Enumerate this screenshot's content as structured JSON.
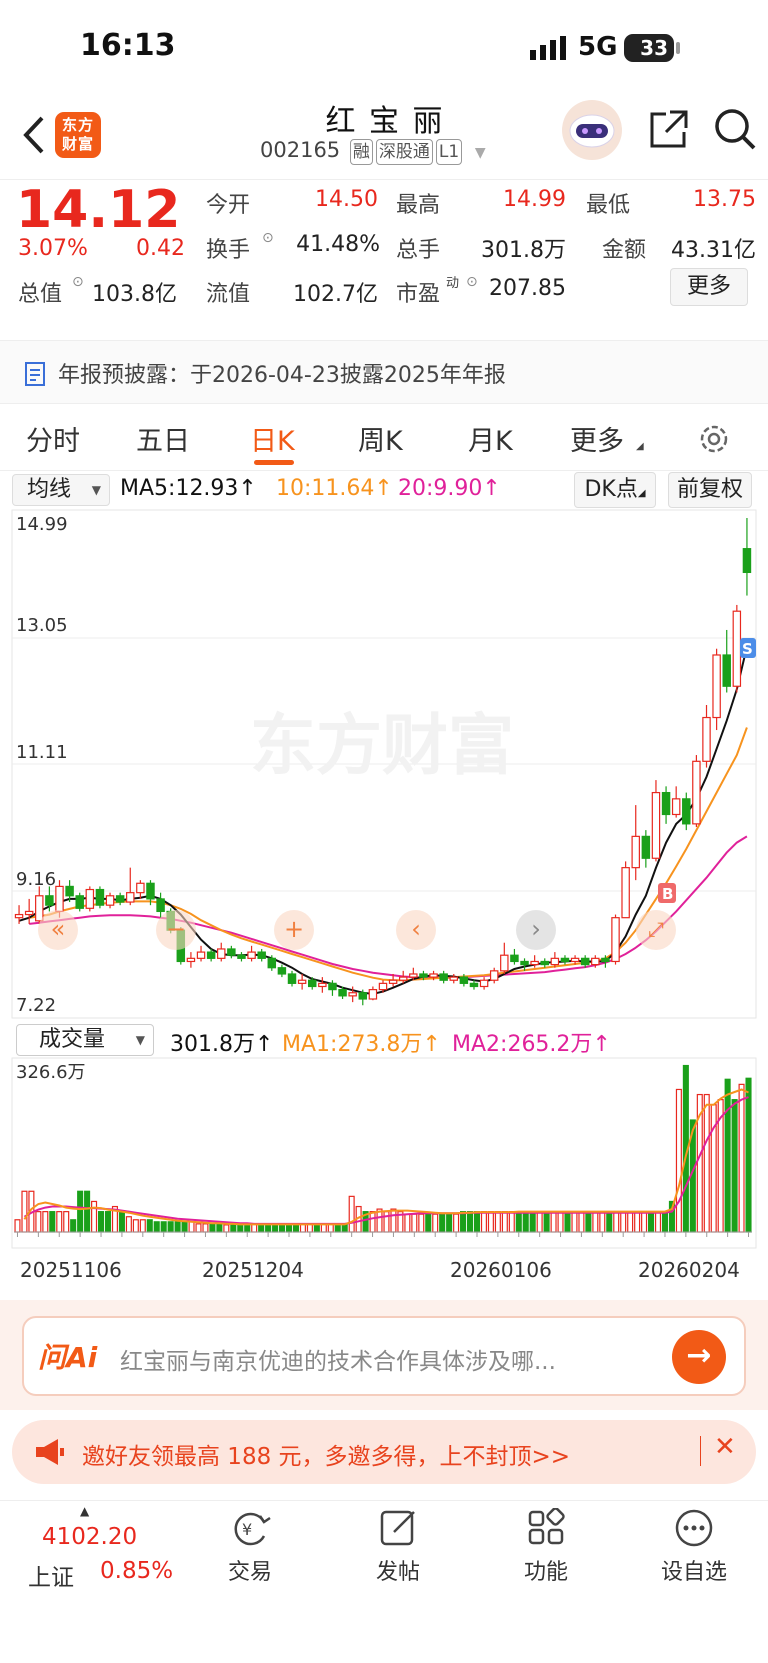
{
  "status_bar": {
    "time": "16:13",
    "network": "5G",
    "battery": "33"
  },
  "header": {
    "logo_text": "东方\n财富",
    "name": "红 宝 丽",
    "code": "002165",
    "tags": [
      "融",
      "深股通",
      "L1"
    ]
  },
  "quote": {
    "price": "14.12",
    "change_pct": "3.07%",
    "change_amt": "0.42",
    "open_label": "今开",
    "open": "14.50",
    "high_label": "最高",
    "high": "14.99",
    "low_label": "最低",
    "low": "13.75",
    "turnover_label": "换手",
    "turnover": "41.48%",
    "volume_label": "总手",
    "volume": "301.8万",
    "amount_label": "金额",
    "amount": "43.31亿",
    "total_cap_label": "总值",
    "total_cap": "103.8亿",
    "float_cap_label": "流值",
    "float_cap": "102.7亿",
    "pe_label": "市盈",
    "pe_sup": "动",
    "pe": "207.85",
    "more_button": "更多"
  },
  "notice": "年报预披露：于2026-04-23披露2025年年报",
  "tabs": [
    "分时",
    "五日",
    "日K",
    "周K",
    "月K",
    "更多"
  ],
  "active_tab": "日K",
  "ma_bar": {
    "select": "均线",
    "ma5": "MA5:12.93",
    "ma10": "10:11.64",
    "ma20": "20:9.90",
    "dk_button": "DK点",
    "fq_button": "前复权"
  },
  "price_axis": [
    "14.99",
    "13.05",
    "11.11",
    "9.16",
    "7.22"
  ],
  "watermark": "东方财富",
  "markers": {
    "buy": "B",
    "sell": "S"
  },
  "volume_bar": {
    "select": "成交量",
    "vol": "301.8万",
    "ma1": "MA1:273.8万",
    "ma2": "MA2:265.2万",
    "max": "326.6万"
  },
  "date_axis": [
    "20251106",
    "20251204",
    "20260106",
    "20260204"
  ],
  "colors": {
    "up": "#e8281e",
    "down": "#1aa01a",
    "ma5": "#111111",
    "ma10": "#f7931e",
    "ma20": "#e0219a",
    "accent": "#f25a16"
  },
  "chart_data": {
    "type": "candlestick",
    "ylim": [
      7.22,
      14.99
    ],
    "candles": [
      {
        "o": 8.6,
        "c": 8.65,
        "h": 8.8,
        "l": 8.5
      },
      {
        "o": 8.65,
        "c": 8.7,
        "h": 8.9,
        "l": 8.5
      },
      {
        "o": 8.55,
        "c": 8.95,
        "h": 9.1,
        "l": 8.5
      },
      {
        "o": 8.95,
        "c": 8.8,
        "h": 9.1,
        "l": 8.7
      },
      {
        "o": 8.7,
        "c": 9.1,
        "h": 9.2,
        "l": 8.6
      },
      {
        "o": 9.1,
        "c": 8.95,
        "h": 9.2,
        "l": 8.85
      },
      {
        "o": 8.95,
        "c": 8.75,
        "h": 9.0,
        "l": 8.7
      },
      {
        "o": 8.75,
        "c": 9.05,
        "h": 9.1,
        "l": 8.7
      },
      {
        "o": 9.05,
        "c": 8.8,
        "h": 9.1,
        "l": 8.75
      },
      {
        "o": 8.8,
        "c": 8.95,
        "h": 9.0,
        "l": 8.75
      },
      {
        "o": 8.95,
        "c": 8.85,
        "h": 9.0,
        "l": 8.8
      },
      {
        "o": 8.85,
        "c": 9.0,
        "h": 9.4,
        "l": 8.8
      },
      {
        "o": 9.0,
        "c": 9.15,
        "h": 9.2,
        "l": 8.9
      },
      {
        "o": 9.15,
        "c": 8.9,
        "h": 9.2,
        "l": 8.8
      },
      {
        "o": 8.9,
        "c": 8.7,
        "h": 9.0,
        "l": 8.6
      },
      {
        "o": 8.7,
        "c": 8.4,
        "h": 8.75,
        "l": 8.35
      },
      {
        "o": 8.4,
        "c": 7.9,
        "h": 8.45,
        "l": 7.85
      },
      {
        "o": 7.9,
        "c": 7.95,
        "h": 8.05,
        "l": 7.8
      },
      {
        "o": 7.95,
        "c": 8.05,
        "h": 8.15,
        "l": 7.9
      },
      {
        "o": 8.05,
        "c": 7.95,
        "h": 8.1,
        "l": 7.9
      },
      {
        "o": 7.95,
        "c": 8.1,
        "h": 8.2,
        "l": 7.9
      },
      {
        "o": 8.1,
        "c": 8.0,
        "h": 8.15,
        "l": 7.95
      },
      {
        "o": 8.0,
        "c": 7.95,
        "h": 8.05,
        "l": 7.9
      },
      {
        "o": 7.95,
        "c": 8.05,
        "h": 8.15,
        "l": 7.9
      },
      {
        "o": 8.05,
        "c": 7.95,
        "h": 8.1,
        "l": 7.9
      },
      {
        "o": 7.95,
        "c": 7.8,
        "h": 8.0,
        "l": 7.75
      },
      {
        "o": 7.8,
        "c": 7.7,
        "h": 7.85,
        "l": 7.65
      },
      {
        "o": 7.7,
        "c": 7.55,
        "h": 7.75,
        "l": 7.5
      },
      {
        "o": 7.55,
        "c": 7.6,
        "h": 7.7,
        "l": 7.45
      },
      {
        "o": 7.6,
        "c": 7.5,
        "h": 7.65,
        "l": 7.45
      },
      {
        "o": 7.5,
        "c": 7.55,
        "h": 7.65,
        "l": 7.4
      },
      {
        "o": 7.55,
        "c": 7.45,
        "h": 7.6,
        "l": 7.35
      },
      {
        "o": 7.45,
        "c": 7.35,
        "h": 7.5,
        "l": 7.3
      },
      {
        "o": 7.35,
        "c": 7.4,
        "h": 7.5,
        "l": 7.25
      },
      {
        "o": 7.4,
        "c": 7.3,
        "h": 7.45,
        "l": 7.2
      },
      {
        "o": 7.3,
        "c": 7.45,
        "h": 7.5,
        "l": 7.28
      },
      {
        "o": 7.45,
        "c": 7.55,
        "h": 7.6,
        "l": 7.4
      },
      {
        "o": 7.55,
        "c": 7.6,
        "h": 7.7,
        "l": 7.5
      },
      {
        "o": 7.6,
        "c": 7.65,
        "h": 7.75,
        "l": 7.55
      },
      {
        "o": 7.65,
        "c": 7.7,
        "h": 7.8,
        "l": 7.6
      },
      {
        "o": 7.7,
        "c": 7.65,
        "h": 7.75,
        "l": 7.6
      },
      {
        "o": 7.65,
        "c": 7.7,
        "h": 7.75,
        "l": 7.6
      },
      {
        "o": 7.7,
        "c": 7.6,
        "h": 7.75,
        "l": 7.55
      },
      {
        "o": 7.6,
        "c": 7.65,
        "h": 7.7,
        "l": 7.55
      },
      {
        "o": 7.65,
        "c": 7.55,
        "h": 7.7,
        "l": 7.5
      },
      {
        "o": 7.55,
        "c": 7.5,
        "h": 7.6,
        "l": 7.45
      },
      {
        "o": 7.5,
        "c": 7.6,
        "h": 7.65,
        "l": 7.45
      },
      {
        "o": 7.6,
        "c": 7.75,
        "h": 7.8,
        "l": 7.55
      },
      {
        "o": 7.75,
        "c": 8.0,
        "h": 8.2,
        "l": 7.7
      },
      {
        "o": 8.0,
        "c": 7.9,
        "h": 8.1,
        "l": 7.85
      },
      {
        "o": 7.9,
        "c": 7.85,
        "h": 7.95,
        "l": 7.75
      },
      {
        "o": 7.85,
        "c": 7.9,
        "h": 8.0,
        "l": 7.8
      },
      {
        "o": 7.9,
        "c": 7.85,
        "h": 7.95,
        "l": 7.8
      },
      {
        "o": 7.85,
        "c": 7.95,
        "h": 8.05,
        "l": 7.8
      },
      {
        "o": 7.95,
        "c": 7.9,
        "h": 8.0,
        "l": 7.85
      },
      {
        "o": 7.9,
        "c": 7.95,
        "h": 8.0,
        "l": 7.85
      },
      {
        "o": 7.95,
        "c": 7.85,
        "h": 8.0,
        "l": 7.8
      },
      {
        "o": 7.85,
        "c": 7.95,
        "h": 8.0,
        "l": 7.8
      },
      {
        "o": 7.95,
        "c": 7.9,
        "h": 8.0,
        "l": 7.8
      },
      {
        "o": 7.9,
        "c": 8.6,
        "h": 8.65,
        "l": 7.85
      },
      {
        "o": 8.6,
        "c": 9.4,
        "h": 9.5,
        "l": 9.0
      },
      {
        "o": 9.4,
        "c": 9.9,
        "h": 10.4,
        "l": 9.2
      },
      {
        "o": 9.9,
        "c": 9.55,
        "h": 10.0,
        "l": 9.4
      },
      {
        "o": 9.55,
        "c": 10.6,
        "h": 10.8,
        "l": 9.5
      },
      {
        "o": 10.6,
        "c": 10.25,
        "h": 10.7,
        "l": 10.1
      },
      {
        "o": 10.25,
        "c": 10.5,
        "h": 10.7,
        "l": 10.2
      },
      {
        "o": 10.5,
        "c": 10.1,
        "h": 10.6,
        "l": 10.0
      },
      {
        "o": 10.1,
        "c": 11.1,
        "h": 11.2,
        "l": 10.05
      },
      {
        "o": 11.1,
        "c": 11.8,
        "h": 12.0,
        "l": 11.0
      },
      {
        "o": 11.8,
        "c": 12.8,
        "h": 12.9,
        "l": 11.6
      },
      {
        "o": 12.8,
        "c": 12.3,
        "h": 13.2,
        "l": 12.2
      },
      {
        "o": 12.3,
        "c": 13.5,
        "h": 13.6,
        "l": 12.2
      },
      {
        "o": 14.5,
        "c": 14.12,
        "h": 14.99,
        "l": 13.75
      }
    ],
    "ma5": [
      8.55,
      8.6,
      8.7,
      8.78,
      8.85,
      8.9,
      8.9,
      8.92,
      8.9,
      8.9,
      8.88,
      8.9,
      8.92,
      8.95,
      8.9,
      8.8,
      8.65,
      8.45,
      8.25,
      8.1,
      8.02,
      8.0,
      8.0,
      8.01,
      8.0,
      7.95,
      7.88,
      7.8,
      7.7,
      7.62,
      7.58,
      7.54,
      7.48,
      7.44,
      7.4,
      7.38,
      7.42,
      7.48,
      7.55,
      7.62,
      7.66,
      7.68,
      7.67,
      7.66,
      7.63,
      7.6,
      7.58,
      7.62,
      7.7,
      7.78,
      7.82,
      7.85,
      7.88,
      7.89,
      7.9,
      7.91,
      7.9,
      7.9,
      7.9,
      8.05,
      8.3,
      8.65,
      8.95,
      9.4,
      9.8,
      10.1,
      10.25,
      10.5,
      10.85,
      11.3,
      11.75,
      12.25,
      12.93
    ],
    "ma10": [
      8.6,
      8.62,
      8.65,
      8.7,
      8.74,
      8.78,
      8.8,
      8.82,
      8.84,
      8.85,
      8.86,
      8.86,
      8.86,
      8.84,
      8.8,
      8.74,
      8.66,
      8.56,
      8.48,
      8.4,
      8.33,
      8.27,
      8.22,
      8.17,
      8.12,
      8.07,
      8.02,
      7.97,
      7.92,
      7.87,
      7.82,
      7.77,
      7.72,
      7.68,
      7.64,
      7.61,
      7.6,
      7.6,
      7.61,
      7.62,
      7.63,
      7.64,
      7.65,
      7.66,
      7.67,
      7.68,
      7.7,
      7.72,
      7.74,
      7.76,
      7.78,
      7.8,
      7.82,
      7.84,
      7.86,
      7.88,
      7.9,
      7.95,
      8.05,
      8.2,
      8.4,
      8.65,
      8.9,
      9.15,
      9.42,
      9.7,
      10.0,
      10.3,
      10.6,
      10.9,
      11.2,
      11.64
    ],
    "ma20": [
      8.5,
      8.52,
      8.54,
      8.56,
      8.58,
      8.6,
      8.62,
      8.63,
      8.64,
      8.64,
      8.64,
      8.63,
      8.62,
      8.6,
      8.58,
      8.55,
      8.52,
      8.48,
      8.44,
      8.4,
      8.36,
      8.31,
      8.26,
      8.21,
      8.16,
      8.11,
      8.06,
      8.01,
      7.96,
      7.91,
      7.86,
      7.82,
      7.78,
      7.75,
      7.72,
      7.7,
      7.68,
      7.66,
      7.65,
      7.64,
      7.64,
      7.64,
      7.64,
      7.65,
      7.66,
      7.67,
      7.68,
      7.69,
      7.7,
      7.71,
      7.72,
      7.73,
      7.75,
      7.77,
      7.79,
      7.81,
      7.84,
      7.88,
      7.94,
      8.02,
      8.12,
      8.24,
      8.38,
      8.54,
      8.7,
      8.88,
      9.06,
      9.24,
      9.44,
      9.64,
      9.8,
      9.9
    ],
    "volume": [
      24,
      80,
      80,
      40,
      40,
      40,
      40,
      40,
      24,
      80,
      80,
      60,
      40,
      40,
      50,
      40,
      30,
      24,
      24,
      24,
      20,
      20,
      20,
      20,
      20,
      20,
      16,
      16,
      16,
      16,
      14,
      14,
      14,
      14,
      16,
      16,
      16,
      16,
      16,
      16,
      16,
      16,
      16,
      16,
      16,
      16,
      14,
      14,
      70,
      50,
      40,
      40,
      45,
      40,
      45,
      40,
      35,
      35,
      35,
      35,
      35,
      35,
      35,
      35,
      40,
      40,
      40,
      40,
      40,
      40,
      40,
      40,
      40,
      40,
      40,
      40,
      40,
      40,
      40,
      40,
      40,
      40,
      40,
      40,
      40,
      40,
      40,
      40,
      40,
      40,
      40,
      40,
      40,
      40,
      60,
      280,
      327,
      220,
      270,
      270,
      250,
      260,
      300,
      260,
      290,
      302
    ],
    "vol_ma1": [
      25,
      45,
      55,
      58,
      55,
      52,
      48,
      46,
      45,
      46,
      48,
      47,
      44,
      42,
      40,
      38,
      35,
      32,
      30,
      28,
      26,
      24,
      22,
      21,
      20,
      19,
      18,
      17,
      17,
      16,
      16,
      15,
      15,
      15,
      15,
      15,
      15,
      15,
      15,
      15,
      15,
      15,
      15,
      15,
      15,
      15,
      15,
      20,
      28,
      34,
      38,
      40,
      41,
      42,
      42,
      42,
      41,
      40,
      39,
      38,
      37,
      37,
      37,
      38,
      38,
      39,
      39,
      39,
      39,
      39,
      39,
      40,
      40,
      40,
      40,
      40,
      40,
      40,
      40,
      40,
      40,
      40,
      40,
      40,
      40,
      40,
      40,
      40,
      40,
      40,
      40,
      40,
      40,
      45,
      90,
      150,
      200,
      230,
      250,
      250,
      262,
      270,
      275,
      280,
      274
    ],
    "vol_ma2": [
      30,
      38,
      44,
      48,
      50,
      50,
      50,
      49,
      48,
      47,
      47,
      46,
      45,
      44,
      42,
      40,
      38,
      36,
      34,
      32,
      30,
      28,
      26,
      25,
      24,
      23,
      22,
      21,
      20,
      19,
      18,
      17,
      17,
      16,
      16,
      16,
      16,
      16,
      16,
      16,
      16,
      16,
      16,
      16,
      16,
      16,
      16,
      18,
      21,
      24,
      27,
      29,
      31,
      33,
      34,
      35,
      36,
      37,
      37,
      37,
      37,
      37,
      37,
      37,
      38,
      38,
      38,
      38,
      38,
      38,
      38,
      38,
      38,
      38,
      38,
      38,
      38,
      38,
      38,
      38,
      38,
      38,
      38,
      38,
      38,
      38,
      38,
      38,
      38,
      38,
      38,
      38,
      38,
      40,
      60,
      90,
      120,
      150,
      180,
      205,
      225,
      240,
      252,
      260,
      265
    ]
  },
  "ai_bar": {
    "brand": "问Ai",
    "prompt": "红宝丽与南京优迪的技术合作具体涉及哪..."
  },
  "promo": {
    "text": "邀好友领最高 188 元，多邀多得，上不封顶>>"
  },
  "bottom_nav": {
    "index_value": "4102.20",
    "index_name": "上证",
    "index_pct": "0.85%",
    "items": [
      "交易",
      "发帖",
      "功能",
      "设自选"
    ]
  }
}
